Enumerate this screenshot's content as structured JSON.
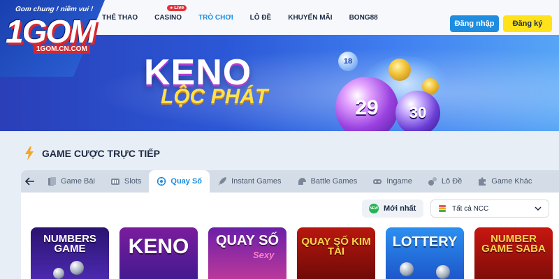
{
  "header": {
    "logo": {
      "slogan": "Gom chung ! niềm vui !",
      "brand": "1GOM",
      "domain": "1GOM.CN.COM"
    },
    "nav": [
      {
        "label": "THỂ THAO",
        "active": false
      },
      {
        "label": "CASINO",
        "active": false,
        "badge": "Live"
      },
      {
        "label": "TRÒ CHƠI",
        "active": true
      },
      {
        "label": "LÔ ĐỀ",
        "active": false
      },
      {
        "label": "KHUYẾN MÃI",
        "active": false
      },
      {
        "label": "BONG88",
        "active": false
      }
    ],
    "login_label": "Đăng nhập",
    "register_label": "Đăng ký"
  },
  "banner": {
    "title": "KENO",
    "subtitle": "LỘC PHÁT",
    "balls": [
      "29",
      "30",
      "18"
    ]
  },
  "section": {
    "title": "GAME CƯỢC TRỰC TIẾP",
    "tabs": [
      {
        "label": "Game Bài",
        "icon": "cards-icon",
        "active": false
      },
      {
        "label": "Slots",
        "icon": "slots-icon",
        "active": false
      },
      {
        "label": "Quay Số",
        "icon": "lottery-icon",
        "active": true
      },
      {
        "label": "Instant Games",
        "icon": "rocket-icon",
        "active": false
      },
      {
        "label": "Battle Games",
        "icon": "helmet-icon",
        "active": false
      },
      {
        "label": "Ingame",
        "icon": "gamepad-icon",
        "active": false
      },
      {
        "label": "Lô Đề",
        "icon": "dice-icon",
        "active": false
      },
      {
        "label": "Game Khác",
        "icon": "puzzle-icon",
        "active": false
      }
    ],
    "sort": {
      "badge": "NEW",
      "label": "Mới nhất"
    },
    "provider": {
      "selected": "Tất cả NCC"
    },
    "games": [
      {
        "title": "NUMBERS GAME"
      },
      {
        "title": "KENO"
      },
      {
        "title": "QUAY SỐ",
        "sub": "Sexy"
      },
      {
        "title": "QUAY SỐ KIM TÀI"
      },
      {
        "title": "LOTTERY"
      },
      {
        "title": "NUMBER GAME SABA"
      }
    ]
  },
  "colors": {
    "accent": "#1e8de0",
    "register": "#ffe21a",
    "live": "#e2343b",
    "text": "#1d2a44"
  }
}
